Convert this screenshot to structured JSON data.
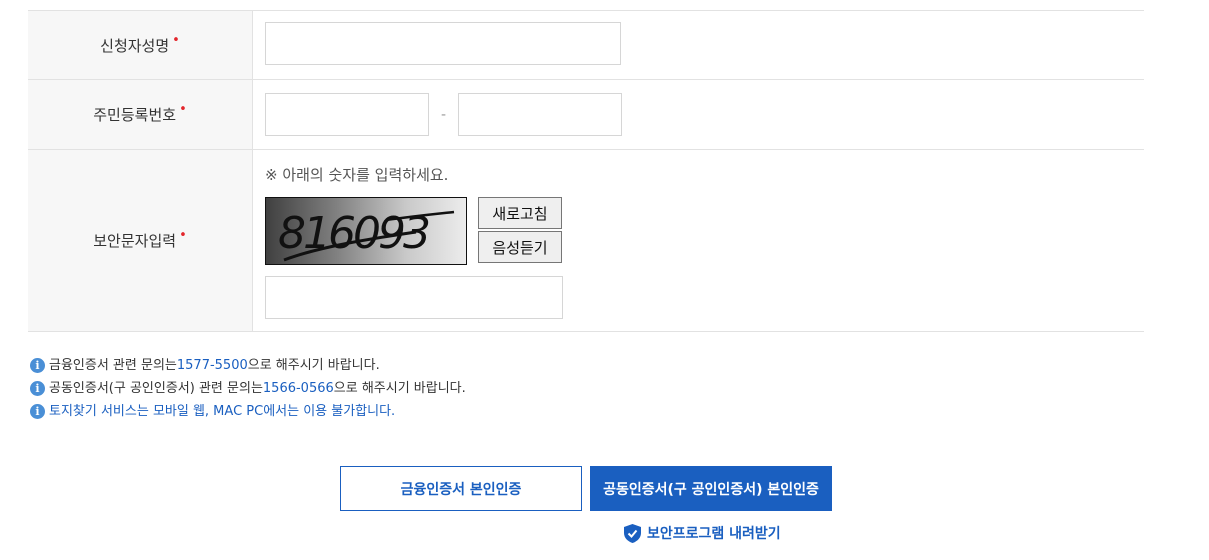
{
  "form": {
    "name_label": "신청자성명",
    "rrn_label": "주민등록번호",
    "rrn_dash": "-",
    "captcha_label": "보안문자입력",
    "required_mark": "•",
    "captcha_note": "※ 아래의 숫자를 입력하세요.",
    "captcha_text": "816093",
    "refresh_label": "새로고침",
    "audio_label": "음성듣기"
  },
  "notices": [
    {
      "pre": "금융인증서 관련 문의는",
      "phone": "1577-5500",
      "post": " 으로 해주시기 바랍니다."
    },
    {
      "pre": "공동인증서(구 공인인증서) 관련 문의는",
      "phone": "1566-0566",
      "post": " 으로 해주시기 바랍니다."
    },
    {
      "text": "토지찾기 서비스는 모바일 웹, MAC PC에서는 이용 불가합니다."
    }
  ],
  "buttons": {
    "financial_cert": "금융인증서 본인인증",
    "joint_cert": "공동인증서(구 공인인증서) 본인인증",
    "download": "보안프로그램 내려받기"
  },
  "colors": {
    "accent": "#1a5fc0",
    "required": "#e3262c",
    "info": "#4a8fd6"
  },
  "icons": {
    "info": "info-icon",
    "shield": "shield-check-icon"
  }
}
